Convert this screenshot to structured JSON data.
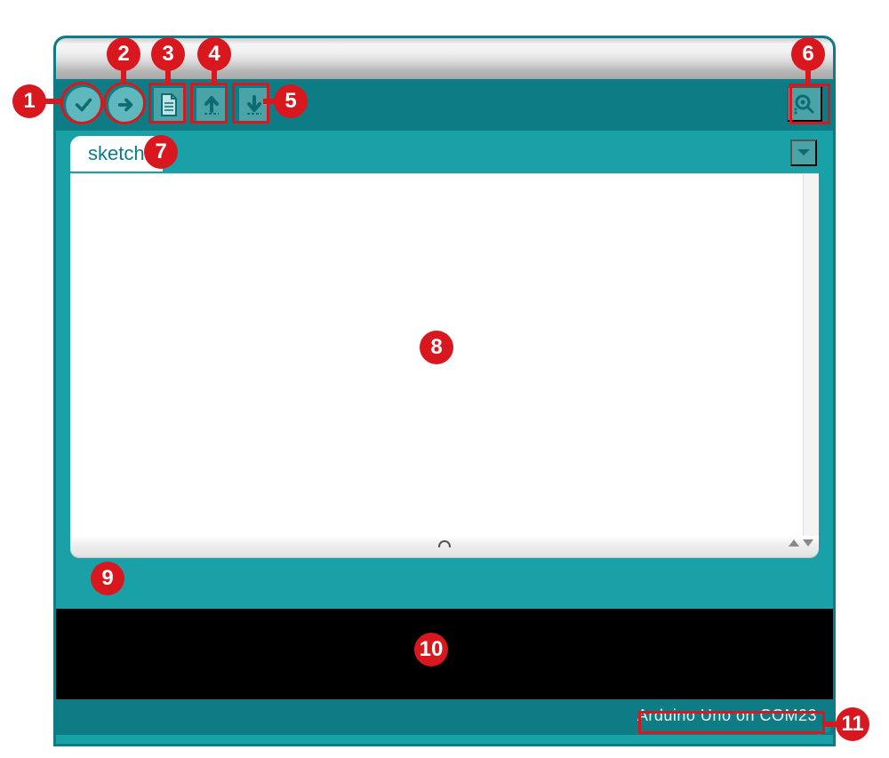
{
  "tab": {
    "label": "sketch"
  },
  "toolbar": {
    "verify_icon": "check-icon",
    "upload_icon": "arrow-right-icon",
    "new_icon": "file-icon",
    "open_icon": "arrow-up-icon",
    "save_icon": "arrow-down-icon",
    "serial_icon": "serial-monitor-icon"
  },
  "footer": {
    "board_port": "Arduino Uno on COM23"
  },
  "annotations": {
    "1": "1",
    "2": "2",
    "3": "3",
    "4": "4",
    "5": "5",
    "6": "6",
    "7": "7",
    "8": "8",
    "9": "9",
    "10": "10",
    "11": "11"
  },
  "colors": {
    "frame": "#0d7c84",
    "accent": "#1aa1a8",
    "button": "#5fb8bb",
    "callout": "#d9171e"
  }
}
